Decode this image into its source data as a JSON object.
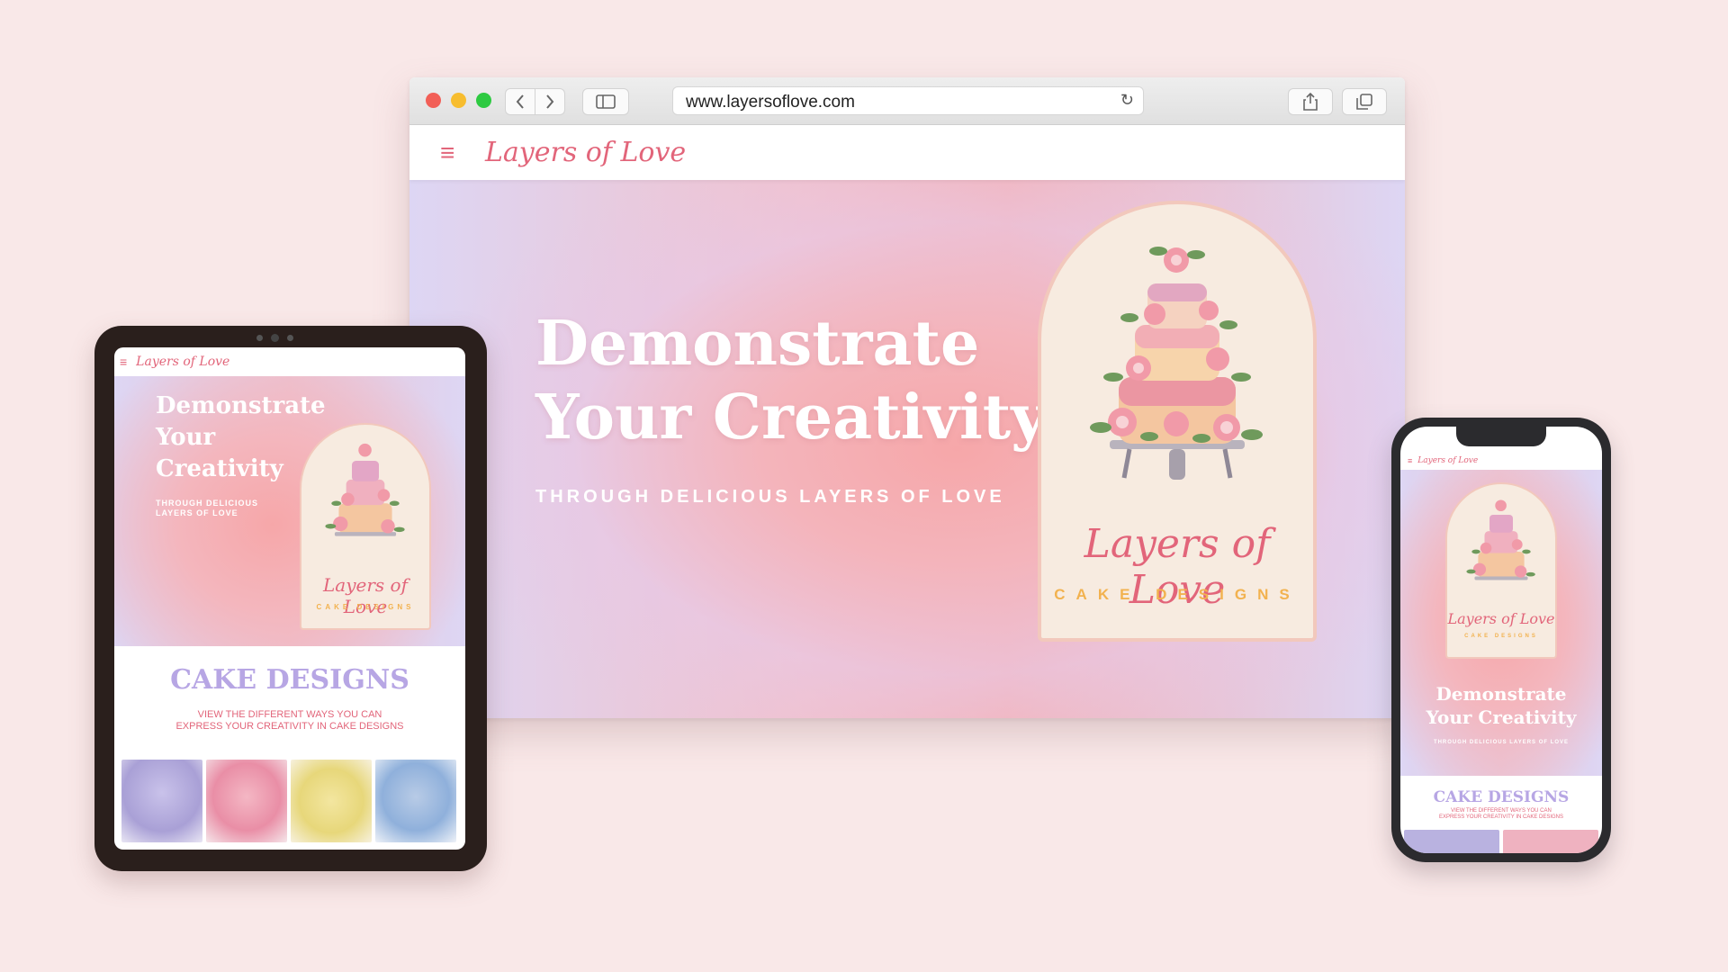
{
  "browser": {
    "url": "www.layersoflove.com",
    "site_logo": "Layers of Love"
  },
  "hero": {
    "title_line1": "Demonstrate",
    "title_line2": "Your Creativity",
    "subtitle": "THROUGH DELICIOUS LAYERS OF LOVE",
    "badge_script": "Layers of Love",
    "badge_sub": "CAKE DESIGNS"
  },
  "tablet": {
    "logo": "Layers of Love",
    "title_line1": "Demonstrate",
    "title_line2": "Your",
    "title_line3": "Creativity",
    "subtitle": "THROUGH DELICIOUS LAYERS OF LOVE",
    "badge_script": "Layers of Love",
    "badge_sub": "CAKE DESIGNS",
    "section_title": "CAKE DESIGNS",
    "section_sub_line1": "VIEW THE DIFFERENT WAYS YOU CAN",
    "section_sub_line2": "EXPRESS YOUR CREATIVITY IN CAKE DESIGNS"
  },
  "phone": {
    "logo": "Layers of Love",
    "badge_script": "Layers of Love",
    "badge_sub": "CAKE DESIGNS",
    "title_line1": "Demonstrate",
    "title_line2": "Your Creativity",
    "subtitle": "THROUGH DELICIOUS LAYERS OF LOVE",
    "section_title": "CAKE DESIGNS",
    "section_sub_line1": "VIEW THE DIFFERENT WAYS YOU CAN",
    "section_sub_line2": "EXPRESS YOUR CREATIVITY IN CAKE DESIGNS"
  },
  "colors": {
    "background": "#f9e8e8",
    "accent": "#e2657a",
    "lavender": "#b7a6e4",
    "gold": "#f2b24f"
  },
  "icons": [
    "chevron-left-icon",
    "chevron-right-icon",
    "sidebar-icon",
    "reload-icon",
    "share-icon",
    "tabs-icon",
    "hamburger-icon",
    "cake-illustration-icon"
  ]
}
